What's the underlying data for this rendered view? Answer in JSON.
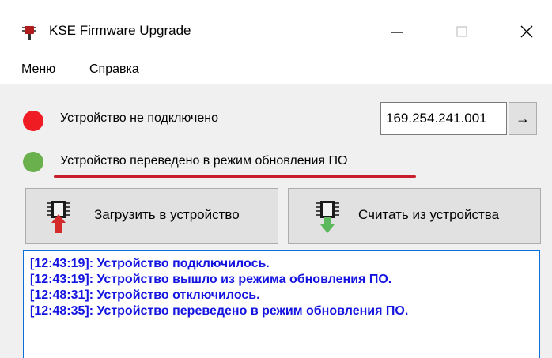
{
  "window": {
    "title": "KSE Firmware Upgrade",
    "controls": [
      "minimize",
      "maximize",
      "close"
    ]
  },
  "menu": {
    "items": [
      "Меню",
      "Справка"
    ]
  },
  "connection": {
    "status_text": "Устройство не подключено",
    "status_color": "#ef1c24",
    "ip_value": "169.254.241.001",
    "go_label": "→"
  },
  "mode": {
    "status_text": "Устройство переведено в режим обновления ПО",
    "status_color": "#6ab04c",
    "underline_color": "#c8202a"
  },
  "actions": {
    "upload_label": "Загрузить в устройство",
    "download_label": "Считать из устройства"
  },
  "log": {
    "text_color": "#1414e0",
    "border_color": "#0a6fd6",
    "lines": [
      "[12:43:19]: Устройство подключилось.",
      "[12:43:19]: Устройство вышло из режима обновления ПО.",
      "[12:48:31]: Устройство отключилось.",
      "[12:48:35]: Устройство переведено в режим обновления ПО."
    ]
  }
}
